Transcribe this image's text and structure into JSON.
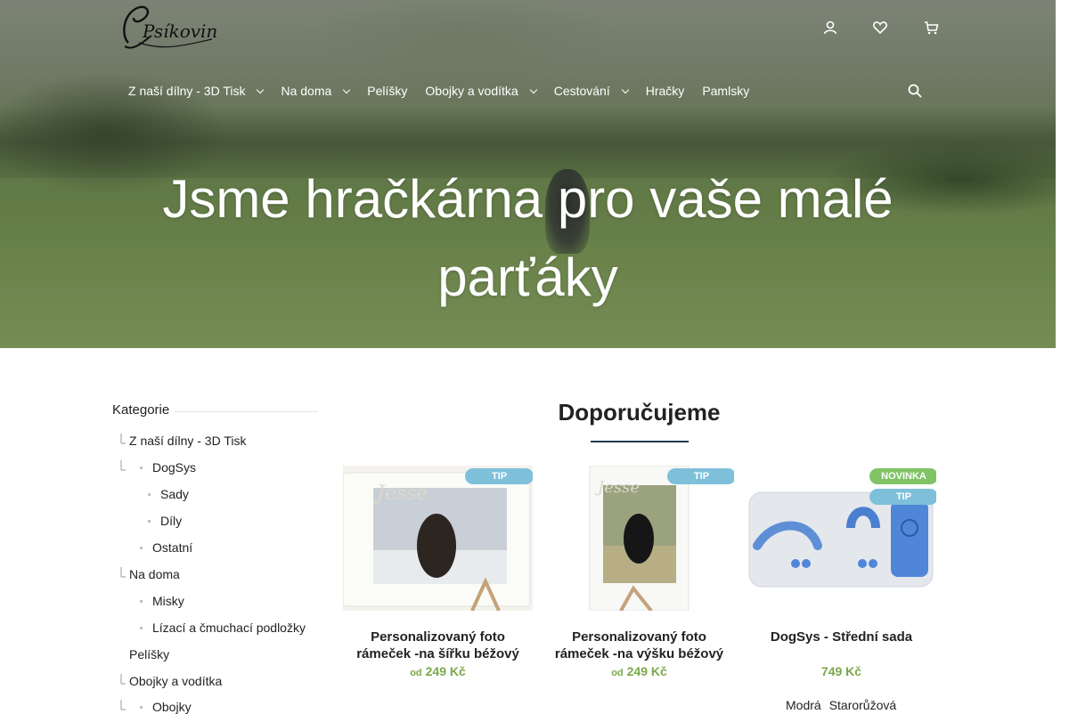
{
  "header": {
    "logo_text": "Psíkovina",
    "icons": [
      "user-icon",
      "heart-icon",
      "cart-icon"
    ]
  },
  "nav": {
    "items": [
      {
        "label": "Z naší dílny - 3D Tisk",
        "has_submenu": true
      },
      {
        "label": "Na doma",
        "has_submenu": true
      },
      {
        "label": "Pelíšky",
        "has_submenu": false
      },
      {
        "label": "Obojky a vodítka",
        "has_submenu": true
      },
      {
        "label": "Cestování",
        "has_submenu": true
      },
      {
        "label": "Hračky",
        "has_submenu": false
      },
      {
        "label": "Pamlsky",
        "has_submenu": false
      }
    ]
  },
  "hero": {
    "title_line1": "Jsme hračkárna pro vaše malé",
    "title_line2": "parťáky"
  },
  "sidebar": {
    "title": "Kategorie",
    "categories": [
      {
        "label": "Z naší dílny - 3D Tisk"
      },
      {
        "label": "DogSys"
      },
      {
        "label": "Sady"
      },
      {
        "label": "Díly"
      },
      {
        "label": "Ostatní"
      },
      {
        "label": "Na doma"
      },
      {
        "label": "Misky"
      },
      {
        "label": "Lízací a čmuchací podložky"
      },
      {
        "label": "Pelíšky"
      },
      {
        "label": "Obojky a vodítka"
      },
      {
        "label": "Obojky"
      }
    ]
  },
  "recommended": {
    "title": "Doporučujeme",
    "products": [
      {
        "name": "Personalizovaný foto rámeček -na šířku béžový",
        "price_prefix": "od",
        "price": "249 Kč",
        "badges": [
          "TIP"
        ]
      },
      {
        "name": "Personalizovaný foto rámeček -na výšku béžový",
        "price_prefix": "od",
        "price": "249 Kč",
        "badges": [
          "TIP"
        ]
      },
      {
        "name": "DogSys - Střední sada",
        "price_prefix": "",
        "price": "749 Kč",
        "badges": [
          "NOVINKA",
          "TIP"
        ],
        "variants": [
          "Modrá",
          "Starorůžová"
        ]
      }
    ]
  },
  "colors": {
    "accent_dark": "#1e3a52",
    "price_green": "#7aa84a",
    "badge_tip": "#7ec0da",
    "badge_new": "#7fc465"
  }
}
